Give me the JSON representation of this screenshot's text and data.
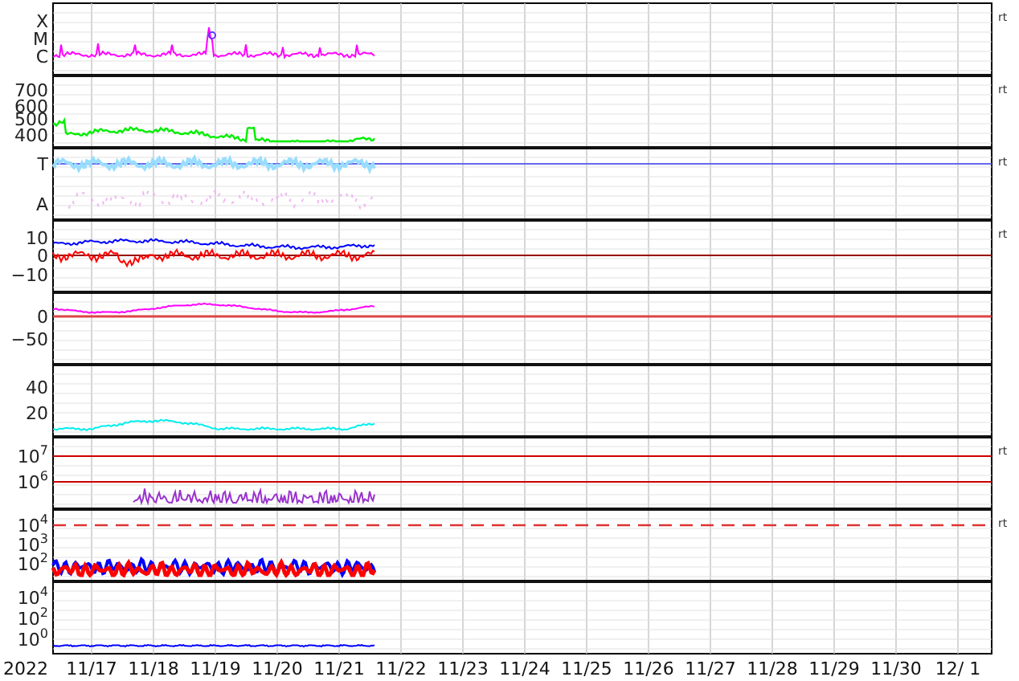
{
  "panels": [
    {
      "kind": "xray",
      "ticks": [
        {
          "label": "X"
        },
        {
          "label": "M"
        },
        {
          "label": "C"
        }
      ],
      "side_label": "rt"
    },
    {
      "kind": "speed",
      "ticks": [
        {
          "label": "700"
        },
        {
          "label": "600"
        },
        {
          "label": "500"
        },
        {
          "label": "400"
        }
      ],
      "side_label": "rt"
    },
    {
      "kind": "temp",
      "ticks": [
        {
          "label": "T"
        },
        {
          "label": "A"
        }
      ],
      "side_label": "rt"
    },
    {
      "kind": "field",
      "ticks": [
        {
          "label": "10"
        },
        {
          "label": "0"
        },
        {
          "label": "−10"
        }
      ],
      "side_label": "rt"
    },
    {
      "kind": "index",
      "ticks": [
        {
          "label": "0"
        },
        {
          "label": "−50"
        }
      ]
    },
    {
      "kind": "density",
      "ticks": [
        {
          "label": "40"
        },
        {
          "label": "20"
        }
      ]
    },
    {
      "kind": "flux",
      "ticks": [
        {
          "label": "10",
          "exp": "7"
        },
        {
          "label": "10",
          "exp": "6"
        }
      ],
      "side_label": "rt"
    },
    {
      "kind": "electron",
      "ticks": [
        {
          "label": "10",
          "exp": "4"
        },
        {
          "label": "10",
          "exp": "3"
        },
        {
          "label": "10",
          "exp": "2"
        }
      ],
      "side_label": "rt"
    },
    {
      "kind": "proton",
      "ticks": [
        {
          "label": "10",
          "exp": "4"
        },
        {
          "label": "10",
          "exp": "2"
        },
        {
          "label": "10",
          "exp": "0"
        }
      ]
    }
  ],
  "year": "2022",
  "dates": [
    "11/17",
    "11/18",
    "11/19",
    "11/20",
    "11/21",
    "11/22",
    "11/23",
    "11/24",
    "11/25",
    "11/26",
    "11/27",
    "11/28",
    "11/29",
    "11/30",
    "12/ 1"
  ]
}
